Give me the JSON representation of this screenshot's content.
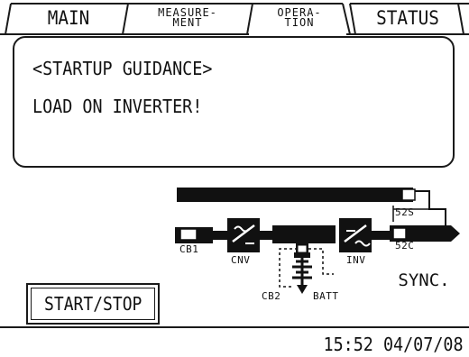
{
  "tabs": [
    {
      "id": "main",
      "label": "MAIN",
      "active": false
    },
    {
      "id": "measurement",
      "label": "MEASURE-",
      "label2": "MENT",
      "active": false
    },
    {
      "id": "operation",
      "label": "OPERA-",
      "label2": "TION",
      "active": true
    },
    {
      "id": "status",
      "label": "STATUS",
      "active": false
    }
  ],
  "guidance": {
    "title": "<STARTUP GUIDANCE>",
    "message": "LOAD ON INVERTER!"
  },
  "diagram": {
    "labels": {
      "cb1": "CB1",
      "cnv": "CNV",
      "inv": "INV",
      "cb2": "CB2",
      "batt": "BATT",
      "s52s": "52S",
      "s52c": "52C"
    }
  },
  "buttons": {
    "start_stop": "START/STOP",
    "sync": "SYNC."
  },
  "status_bar": {
    "clock": "15:52 04/07/08"
  }
}
